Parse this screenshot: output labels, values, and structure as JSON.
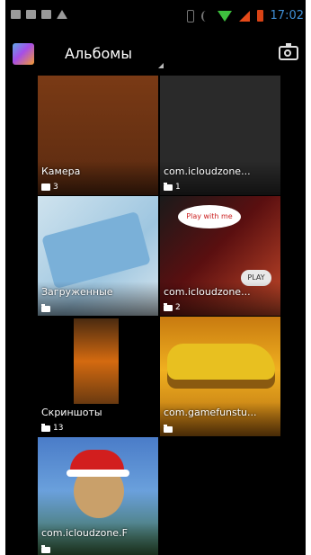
{
  "statusbar": {
    "time": "17:02",
    "left_icons": [
      "mail-icon",
      "image-icon",
      "message-icon",
      "warning-icon"
    ],
    "right_icons": [
      "vibrate-icon",
      "nfc-icon",
      "wifi-icon",
      "signal-icon",
      "battery-icon"
    ],
    "colors": {
      "time": "#3f8fd6",
      "wifi": "#3ec03e",
      "signal": "#e64a19",
      "battery": "#d84315"
    }
  },
  "actionbar": {
    "title": "Альбомы",
    "app_icon": "gallery-app-icon",
    "action_icon": "camera-icon"
  },
  "albums": [
    {
      "name": "Камера",
      "count": "3",
      "type_icon": "camera-icon"
    },
    {
      "name": "com.icloudzone...",
      "count": "1",
      "type_icon": "folder-icon"
    },
    {
      "name": "Загруженные",
      "count": "",
      "type_icon": "folder-icon"
    },
    {
      "name": "com.icloudzone...",
      "count": "2",
      "type_icon": "folder-icon",
      "overlay_text": "Play with me",
      "badge": "PLAY"
    },
    {
      "name": "Скриншоты",
      "count": "13",
      "type_icon": "folder-icon"
    },
    {
      "name": "com.gamefunstu...",
      "count": "",
      "type_icon": "folder-icon"
    },
    {
      "name": "com.icloudzone.F",
      "count": "",
      "type_icon": "folder-icon"
    }
  ]
}
